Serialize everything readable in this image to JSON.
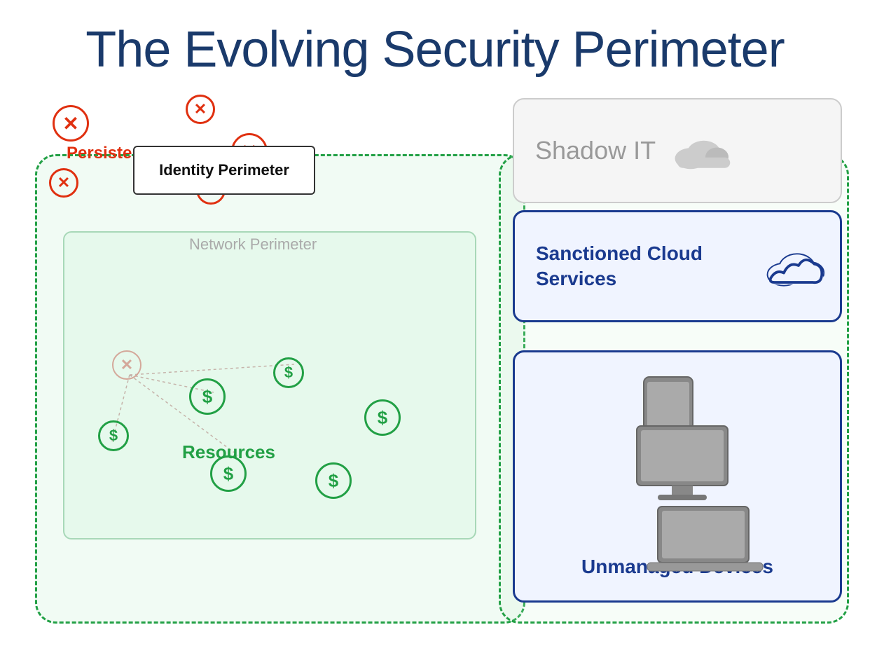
{
  "title": "The Evolving Security Perimeter",
  "labels": {
    "identity_perimeter": "Identity Perimeter",
    "network_perimeter": "Network Perimeter",
    "persistent_threats": "Persistent\nThreats",
    "resources": "Resources",
    "shadow_it": "Shadow IT",
    "sanctioned_cloud": "Sanctioned\nCloud Services",
    "unmanaged_devices": "Unmanaged\nDevices"
  },
  "colors": {
    "title": "#1a3a6b",
    "threat_red": "#e03010",
    "green": "#22a045",
    "navy": "#1a3a8f",
    "gray": "#999999",
    "light_green_bg": "rgba(200,240,210,0.25)"
  }
}
